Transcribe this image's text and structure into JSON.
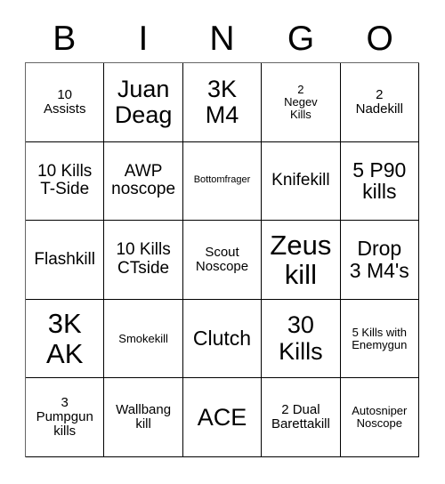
{
  "card": {
    "header_letters": [
      "B",
      "I",
      "N",
      "G",
      "O"
    ],
    "background_color": "#ffffff",
    "text_color": "#000000",
    "border_color": "#000000",
    "cells": [
      {
        "text": "10\nAssists",
        "size": "sm"
      },
      {
        "text": "Juan\nDeag",
        "size": "xl"
      },
      {
        "text": "3K\nM4",
        "size": "xl"
      },
      {
        "text": "2\nNegev\nKills",
        "size": "xs"
      },
      {
        "text": "2\nNadekill",
        "size": "sm"
      },
      {
        "text": "10 Kills\nT-Side",
        "size": "md"
      },
      {
        "text": "AWP\nnoscope",
        "size": "md"
      },
      {
        "text": "Bottomfrager",
        "size": "xxs"
      },
      {
        "text": "Knifekill",
        "size": "md"
      },
      {
        "text": "5 P90\nkills",
        "size": "lg"
      },
      {
        "text": "Flashkill",
        "size": "md"
      },
      {
        "text": "10 Kills\nCTside",
        "size": "md"
      },
      {
        "text": "Scout\nNoscope",
        "size": "sm"
      },
      {
        "text": "Zeus\nkill",
        "size": "xxl"
      },
      {
        "text": "Drop\n3 M4's",
        "size": "lg"
      },
      {
        "text": "3K\nAK",
        "size": "xxl"
      },
      {
        "text": "Smokekill",
        "size": "xs"
      },
      {
        "text": "Clutch",
        "size": "lg"
      },
      {
        "text": "30\nKills",
        "size": "xl"
      },
      {
        "text": "5 Kills with\nEnemygun",
        "size": "xs"
      },
      {
        "text": "3\nPumpgun\nkills",
        "size": "sm"
      },
      {
        "text": "Wallbang\nkill",
        "size": "sm"
      },
      {
        "text": "ACE",
        "size": "xl"
      },
      {
        "text": "2 Dual\nBarettakill",
        "size": "sm"
      },
      {
        "text": "Autosniper\nNoscope",
        "size": "xs"
      }
    ]
  }
}
